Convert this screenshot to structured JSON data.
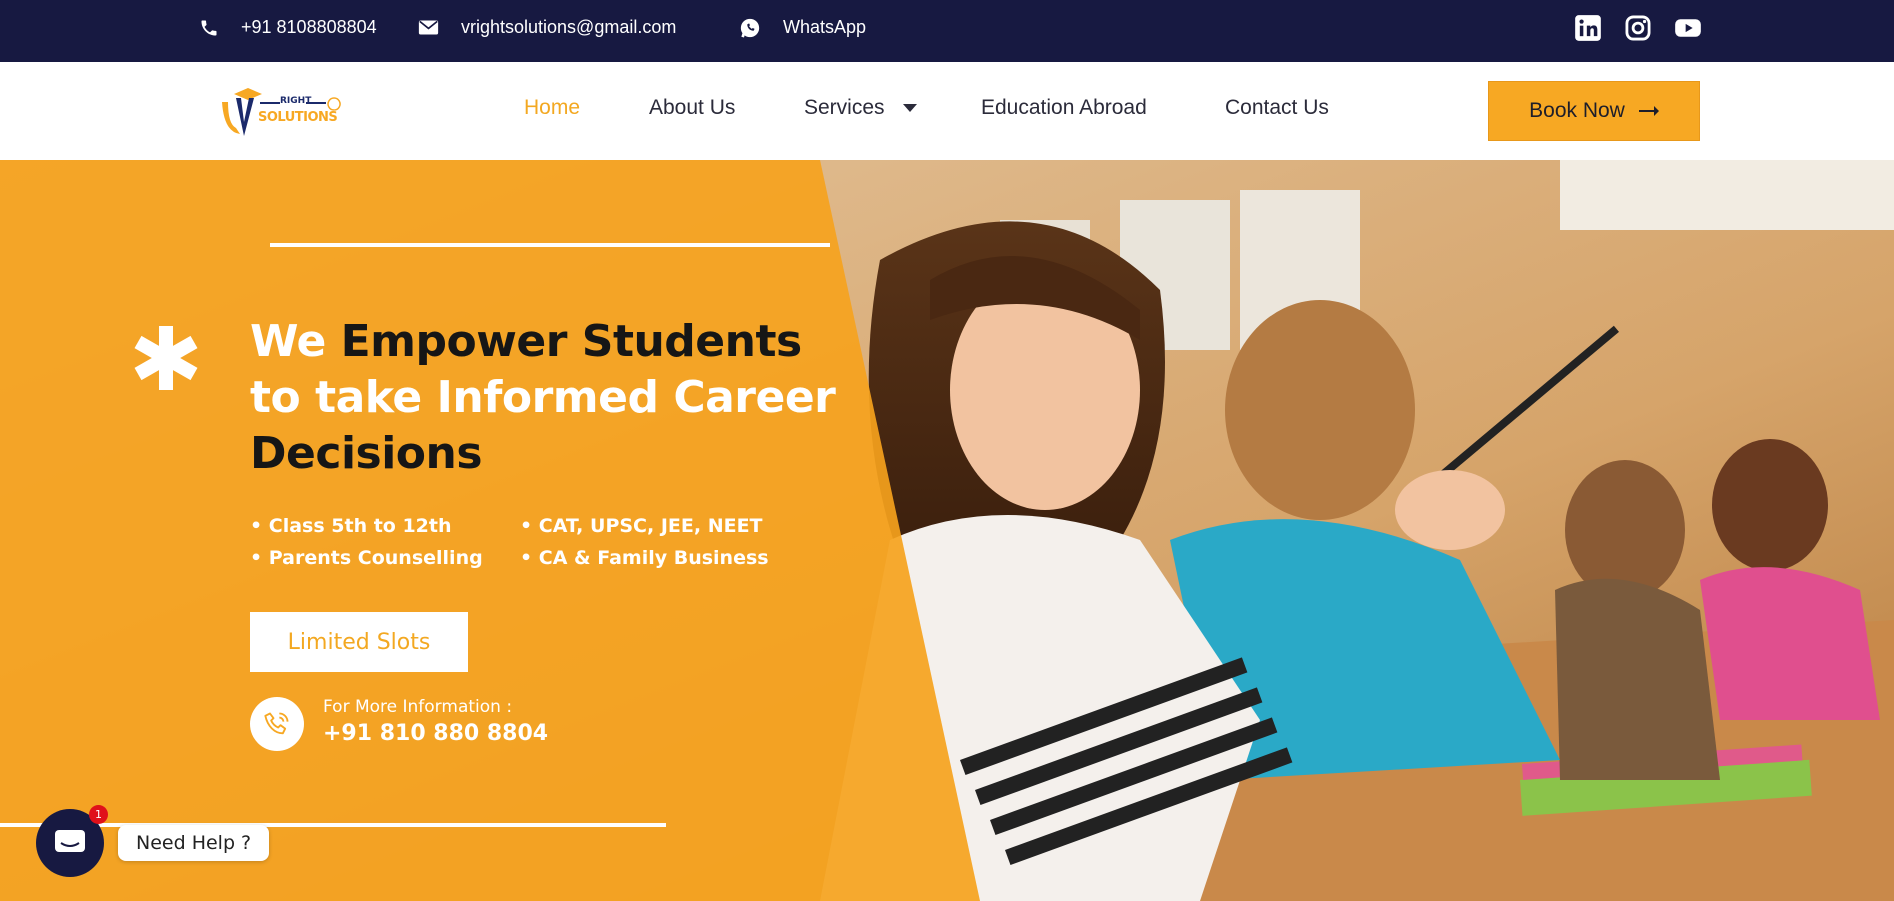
{
  "colors": {
    "topbar_bg": "#171941",
    "accent_orange": "#f7a823",
    "nav_active": "#f3a821",
    "text_dark": "#2b2b3a",
    "badge_red": "#e0111a"
  },
  "topbar": {
    "phone": "+91 8108808804",
    "email": "vrightsolutions@gmail.com",
    "whatsapp": "WhatsApp",
    "icons": [
      "phone-icon",
      "envelope-icon",
      "whatsapp-icon",
      "linkedin-icon",
      "instagram-icon",
      "youtube-icon"
    ]
  },
  "header": {
    "logo": {
      "small_text": "RIGHT",
      "main_text": "SOLUTIONS",
      "letter": "V"
    },
    "nav": [
      {
        "label": "Home",
        "active": true
      },
      {
        "label": "About Us",
        "active": false
      },
      {
        "label": "Services",
        "active": false,
        "has_dropdown": true
      },
      {
        "label": "Education Abroad",
        "active": false
      },
      {
        "label": "Contact Us",
        "active": false
      }
    ],
    "cta_label": "Book Now"
  },
  "hero": {
    "headline": {
      "w1": "We ",
      "d1": "Empower Students",
      "w2": " to take Informed Career",
      "d2": "Decisions"
    },
    "bullets": [
      "• Class 5th to 12th",
      "• Parents Counselling",
      "• CAT, UPSC, JEE, NEET",
      "• CA & Family Business"
    ],
    "slots_button": "Limited Slots",
    "info_label": "For More Information :",
    "info_phone": "+91 810 880 8804"
  },
  "chat": {
    "badge_count": "1",
    "help_text": "Need Help ?"
  }
}
